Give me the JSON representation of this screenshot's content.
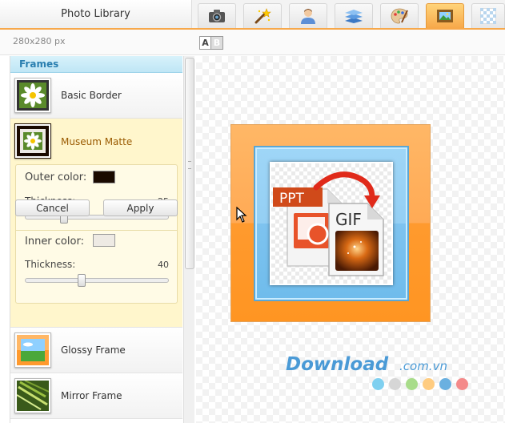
{
  "header": {
    "title": "Photo Library",
    "tabs": [
      {
        "icon": "camera-icon",
        "active": false
      },
      {
        "icon": "magic-wand-icon",
        "active": false
      },
      {
        "icon": "person-icon",
        "active": false
      },
      {
        "icon": "layers-icon",
        "active": false
      },
      {
        "icon": "palette-icon",
        "active": false
      },
      {
        "icon": "frame-picture-icon",
        "active": true
      },
      {
        "icon": "checkerboard-icon",
        "active": false
      }
    ]
  },
  "toolbar": {
    "image_size": "280x280 px",
    "ab_left": "A",
    "ab_right": "B"
  },
  "sidebar": {
    "header": "Frames",
    "items": [
      {
        "label": "Basic Border"
      },
      {
        "label": "Museum Matte",
        "selected": true
      },
      {
        "label": "Glossy Frame"
      },
      {
        "label": "Mirror Frame"
      }
    ],
    "settings": {
      "outer_color_label": "Outer color:",
      "outer_color": "#1a0a00",
      "outer_thickness_label": "Thickness:",
      "outer_thickness": "25",
      "outer_thickness_fraction": 0.25,
      "inner_color_label": "Inner color:",
      "inner_color": "#eeeae4",
      "inner_thickness_label": "Thickness:",
      "inner_thickness": "40",
      "inner_thickness_fraction": 0.38,
      "cancel_label": "Cancel",
      "apply_label": "Apply"
    }
  },
  "preview": {
    "ppt_text": "PPT",
    "gif_text": "GIF",
    "outer_frame_color": "#ff9f3a",
    "inner_frame_color": "#7ec3ef"
  },
  "watermark": {
    "text": "Download",
    "suffix": ".com.vn",
    "dot_colors": [
      "#7fd0f0",
      "#d6d6d6",
      "#a8dc8a",
      "#ffcc80",
      "#6ab0e0",
      "#f48a8a"
    ]
  }
}
